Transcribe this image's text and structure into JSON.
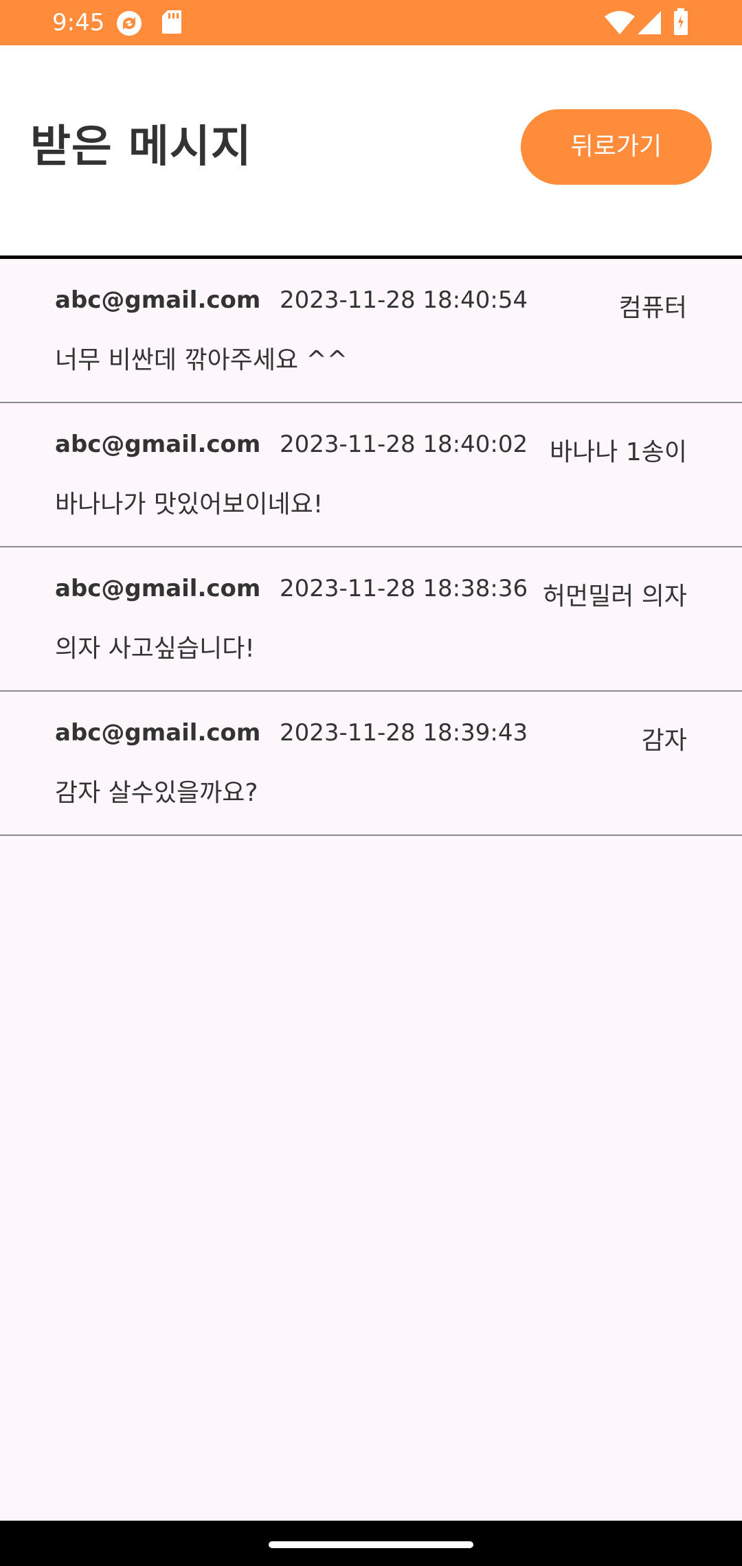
{
  "status_bar": {
    "time": "9:45",
    "color": "#ff8c3a",
    "icons": [
      "sync-icon",
      "sd-card-icon",
      "wifi-icon",
      "signal-icon",
      "battery-icon"
    ]
  },
  "header": {
    "title": "받은 메시지",
    "back_label": "뒤로가기",
    "accent_color": "#ff8c3a"
  },
  "messages": [
    {
      "email": "abc@gmail.com",
      "date": "2023-11-28 18:40:54",
      "title": "컴퓨터",
      "body": "너무 비싼데 깎아주세요 ^^"
    },
    {
      "email": "abc@gmail.com",
      "date": "2023-11-28 18:40:02",
      "title": "바나나 1송이",
      "body": "바나나가 맛있어보이네요!"
    },
    {
      "email": "abc@gmail.com",
      "date": "2023-11-28 18:38:36",
      "title": "허먼밀러 의자",
      "body": "의자 사고싶습니다!"
    },
    {
      "email": "abc@gmail.com",
      "date": "2023-11-28 18:39:43",
      "title": "감자",
      "body": "감자 살수있을까요?"
    }
  ]
}
